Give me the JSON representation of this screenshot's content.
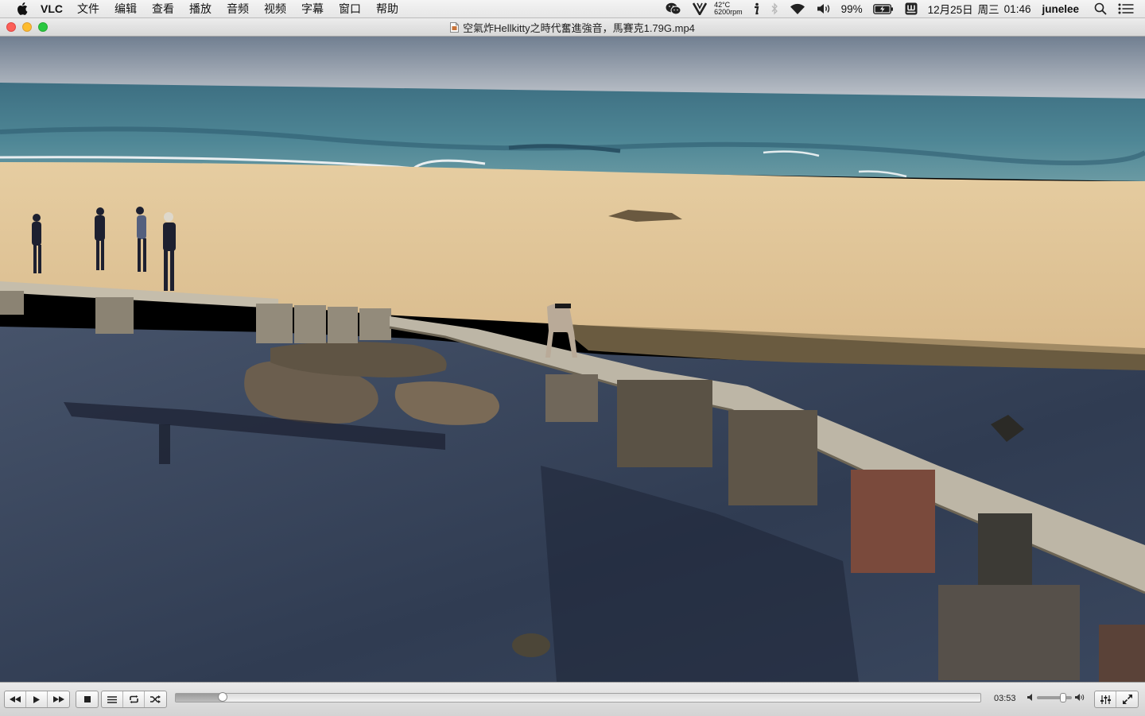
{
  "menubar": {
    "app_name": "VLC",
    "menus": [
      "文件",
      "编辑",
      "查看",
      "播放",
      "音频",
      "视频",
      "字幕",
      "窗口",
      "帮助"
    ],
    "temperature": "42°C",
    "fan_speed": "6200rpm",
    "battery_percent": "99%",
    "date": "12月25日",
    "weekday": "周三",
    "clock": "01:46",
    "user": "junelee"
  },
  "window": {
    "title": "空氣炸Hellkitty之時代奮進強音，馬賽克1.79G.mp4"
  },
  "player": {
    "elapsed_time": "03:53",
    "progress_fraction": 0.058,
    "volume_fraction": 0.74
  },
  "colors": {
    "close": "#fc5f57",
    "minimize": "#fdbc2e",
    "maximize": "#29c840"
  }
}
